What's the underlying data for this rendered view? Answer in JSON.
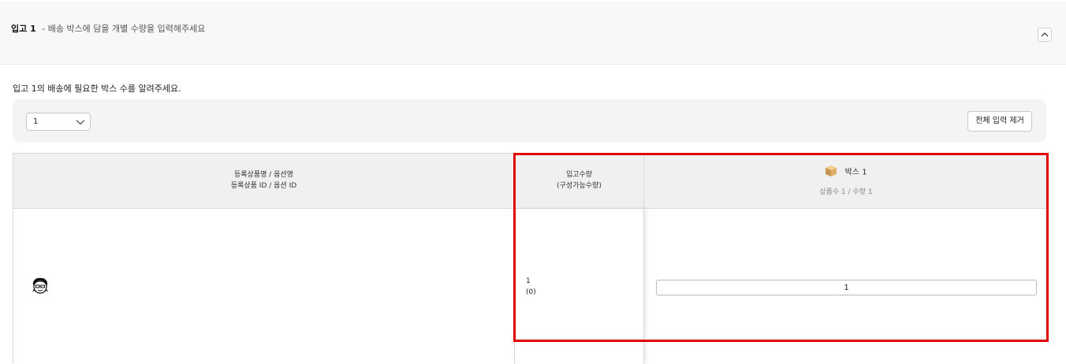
{
  "header": {
    "title": "입고 1",
    "subtitle": "- 배송 박스에 담을 개별 수량을 입력해주세요"
  },
  "prompt": "입고 1의 배송에 필요한 박스 수를 알려주세요.",
  "toolbar": {
    "box_count_value": "1",
    "clear_button_label": "전체 입력 제거"
  },
  "table": {
    "columns": {
      "product_line1": "등록상품명 / 옵션명",
      "product_line2": "등록상품 ID / 옵션 ID",
      "qty_line1": "입고수량",
      "qty_line2": "(구성가능수량)",
      "box_title": "박스 1",
      "box_sub": "상품수 1 / 수량 1"
    },
    "rows": [
      {
        "incoming_qty": "1",
        "available_qty": "(0)",
        "box1_qty": "1"
      }
    ]
  },
  "highlight_color": "#e00000",
  "icons": {
    "collapse": "chevron-up-icon",
    "select": "chevron-down-icon",
    "box": "box-icon",
    "avatar": "avatar-icon"
  }
}
